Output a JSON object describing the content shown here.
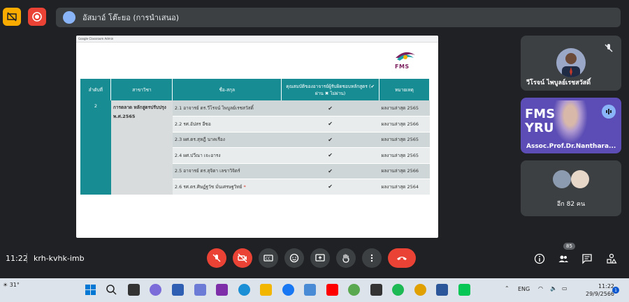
{
  "top_bar": {
    "presenter_name": "อัสมาอ์ โต๊ะยอ (การนำเสนอ)"
  },
  "slide": {
    "tab_text": "Google Classroom Admin",
    "logo_text": "FMS",
    "table": {
      "headers": [
        "ลำดับที่",
        "สาขาวิชา",
        "ชื่อ-สกุล",
        "คุณสมบัติของอาจารย์ผู้รับผิดชอบหลักสูตร (✔ ผ่าน ✖ ไม่ผ่าน)",
        "หมายเหตุ"
      ],
      "row_no": "2",
      "major": "การตลาด หลักสูตรปรับปรุง พ.ศ.2565",
      "rows": [
        {
          "name": "2.1 อาจารย์ ดร.วีโรจน์ ไพบูลย์เรชสวัสดิ์",
          "check": "✔",
          "note": "ผลงานล่าสุด 2565"
        },
        {
          "name": "2.2 รศ.อัปสร อีซอ",
          "check": "✔",
          "note": "ผลงานล่าสุด 2566"
        },
        {
          "name": "2.3 ผศ.ดร.สุหฎี นาคเรือง",
          "check": "✔",
          "note": "ผลงานล่าสุด 2565"
        },
        {
          "name": "2.4 ผศ.ปวีณา เจะอารง",
          "check": "✔",
          "note": "ผลงานล่าสุด 2565"
        },
        {
          "name": "2.5 อาจารย์ ดร.สุจิตา เลขาวิจิตร์",
          "check": "✔",
          "note": "ผลงานล่าสุด 2566"
        },
        {
          "name": "2.6 รศ.ดร.ศิษฏ์ฐวัช มั่นเศรษฐวิทย์",
          "star": "*",
          "check": "✔",
          "note": "ผลงานล่าสุด 2564"
        }
      ]
    }
  },
  "participants": {
    "tile1_name": "วีโรจน์ ไพบูลย์เรชสวัสดิ์",
    "tile2_name": "Assoc.Prof.Dr.Nanthara...",
    "tile2_bg_text": "FMS\nYRU",
    "tile3_more": "อีก 82 คน"
  },
  "controls": {
    "time": "11:22",
    "meeting_code": "krh-kvhk-imb",
    "people_count": "85"
  },
  "taskbar": {
    "weather": "31°",
    "lang": "ENG",
    "clock_time": "11:22",
    "clock_date": "29/9/2566",
    "notif_count": "1"
  },
  "colors": {
    "table_header": "#178c93",
    "meet_bg": "#202124",
    "end_call": "#ea4335"
  }
}
